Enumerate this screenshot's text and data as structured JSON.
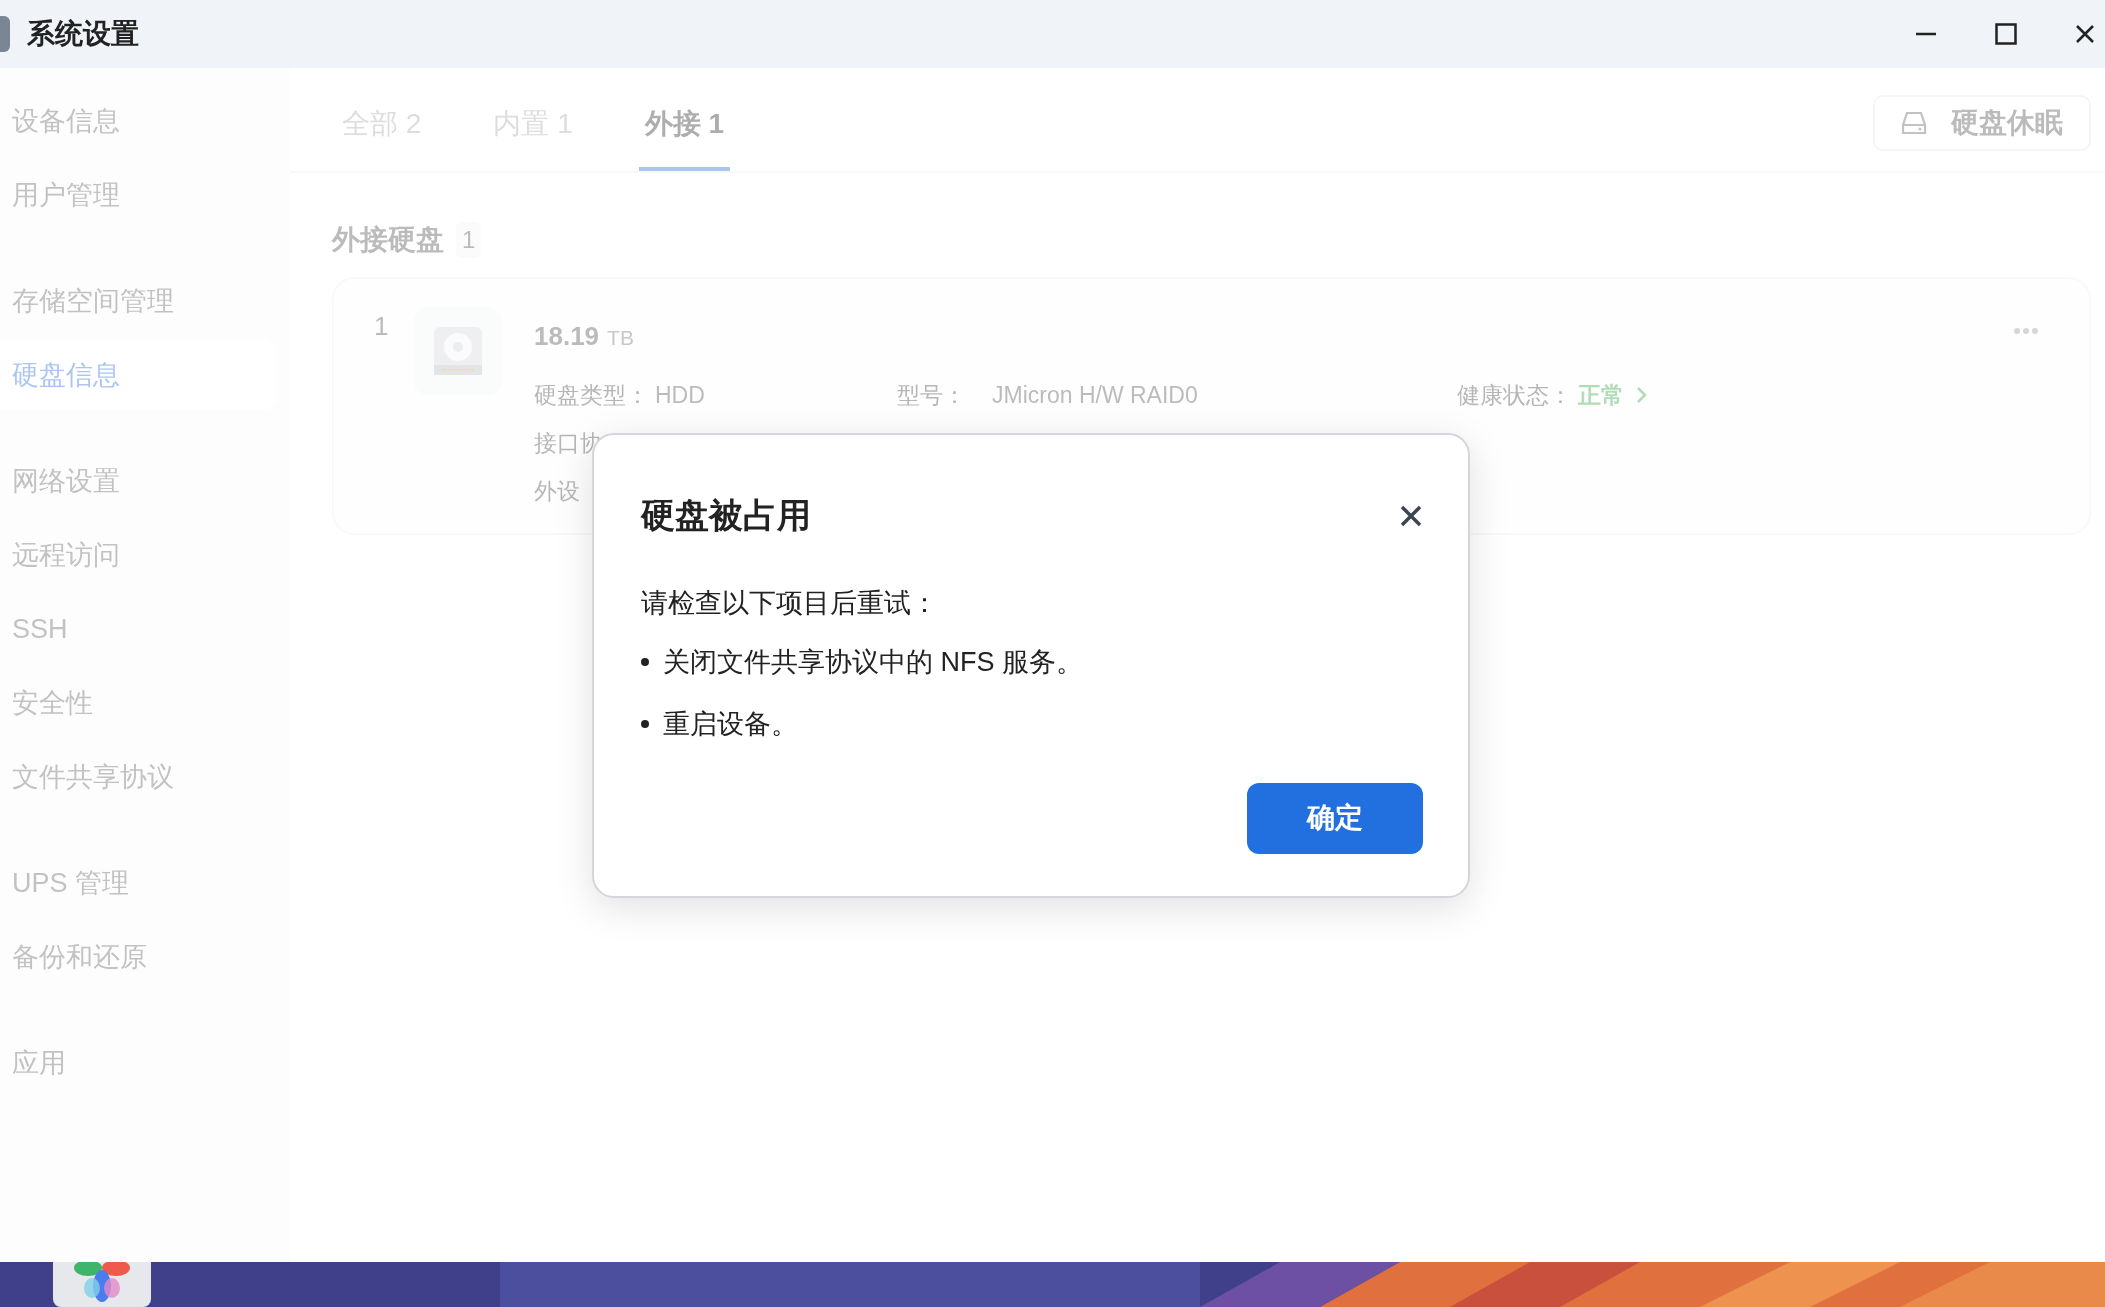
{
  "window": {
    "title": "系统设置"
  },
  "sidebar": {
    "groups": [
      {
        "items": [
          {
            "label": "设备信息",
            "selected": false
          },
          {
            "label": "用户管理",
            "selected": false
          }
        ]
      },
      {
        "items": [
          {
            "label": "存储空间管理",
            "selected": false
          },
          {
            "label": "硬盘信息",
            "selected": true
          }
        ]
      },
      {
        "items": [
          {
            "label": "网络设置",
            "selected": false
          },
          {
            "label": "远程访问",
            "selected": false
          },
          {
            "label": "SSH",
            "selected": false
          },
          {
            "label": "安全性",
            "selected": false
          },
          {
            "label": "文件共享协议",
            "selected": false
          }
        ]
      },
      {
        "items": [
          {
            "label": "UPS 管理",
            "selected": false
          },
          {
            "label": "备份和还原",
            "selected": false
          }
        ]
      },
      {
        "items": [
          {
            "label": "应用",
            "selected": false
          }
        ]
      }
    ]
  },
  "tabs": [
    {
      "label": "全部 2",
      "selected": false
    },
    {
      "label": "内置 1",
      "selected": false
    },
    {
      "label": "外接 1",
      "selected": true
    }
  ],
  "sleep_button": {
    "label": "硬盘休眠"
  },
  "section": {
    "title": "外接硬盘",
    "count": "1"
  },
  "disks": [
    {
      "index": "1",
      "capacity": "18.19",
      "unit": "TB",
      "rows": [
        [
          {
            "kind": "text",
            "label": "硬盘类型：",
            "value": "HDD"
          },
          {
            "kind": "text",
            "label": "型号：",
            "value": "JMicron H/W RAID0"
          },
          {
            "kind": "status",
            "label": "健康状态：",
            "value": "正常"
          }
        ],
        [
          {
            "label": "接口协"
          }
        ],
        [
          {
            "label": "外设"
          }
        ]
      ]
    }
  ],
  "dialog": {
    "title": "硬盘被占用",
    "intro": "请检查以下项目后重试：",
    "bullets": [
      "关闭文件共享协议中的 NFS 服务。",
      "重启设备。"
    ],
    "confirm": "确定"
  }
}
